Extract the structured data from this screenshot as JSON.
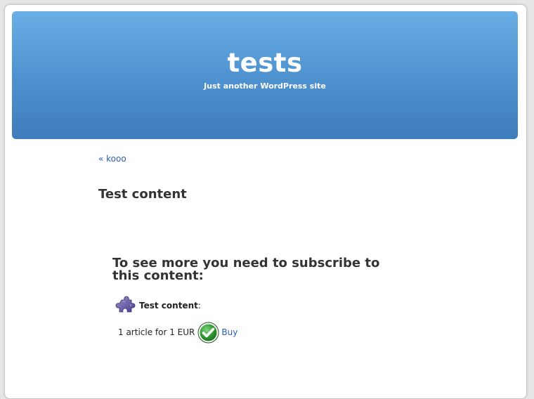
{
  "header": {
    "site_title": "tests",
    "site_description": "Just another WordPress site"
  },
  "navigation": {
    "previous_link": "« kooo"
  },
  "post": {
    "title": "Test content"
  },
  "paywall": {
    "heading": "To see more you need to subscribe to this content:",
    "product": {
      "name": "Test content",
      "suffix": ":",
      "icon": "puzzle-icon"
    },
    "offer": {
      "text": "1 article for 1 EUR",
      "icon": "checkmark-icon",
      "buy_label": "Buy"
    }
  },
  "colors": {
    "header_top": "#6aaee6",
    "header_bottom": "#3e7cba",
    "link": "#2a5db0",
    "check_green": "#2e8b2e"
  }
}
